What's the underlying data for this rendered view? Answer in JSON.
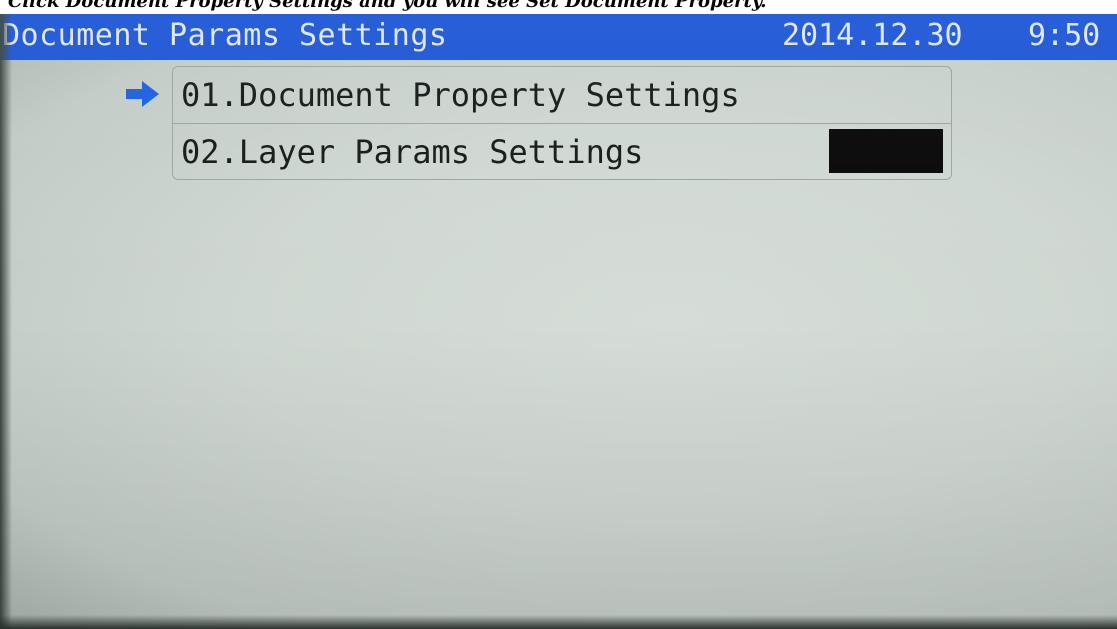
{
  "caption": {
    "text": "Click Document Property Settings and you will see Set Document Property."
  },
  "header": {
    "title": "Document Params Settings",
    "date": "2014.12.30",
    "time": "9:50",
    "background_color": "#1d56d6"
  },
  "menu": {
    "selected_index": 0,
    "pointer_icon": "arrow-right-icon",
    "pointer_color": "#1e5fe0",
    "items": [
      {
        "label": "01.Document Property Settings"
      },
      {
        "label": "02.Layer Params Settings"
      }
    ]
  },
  "colors": {
    "screen_background": "#cfd7d2",
    "text": "#141a18",
    "value_block": "#070707"
  }
}
